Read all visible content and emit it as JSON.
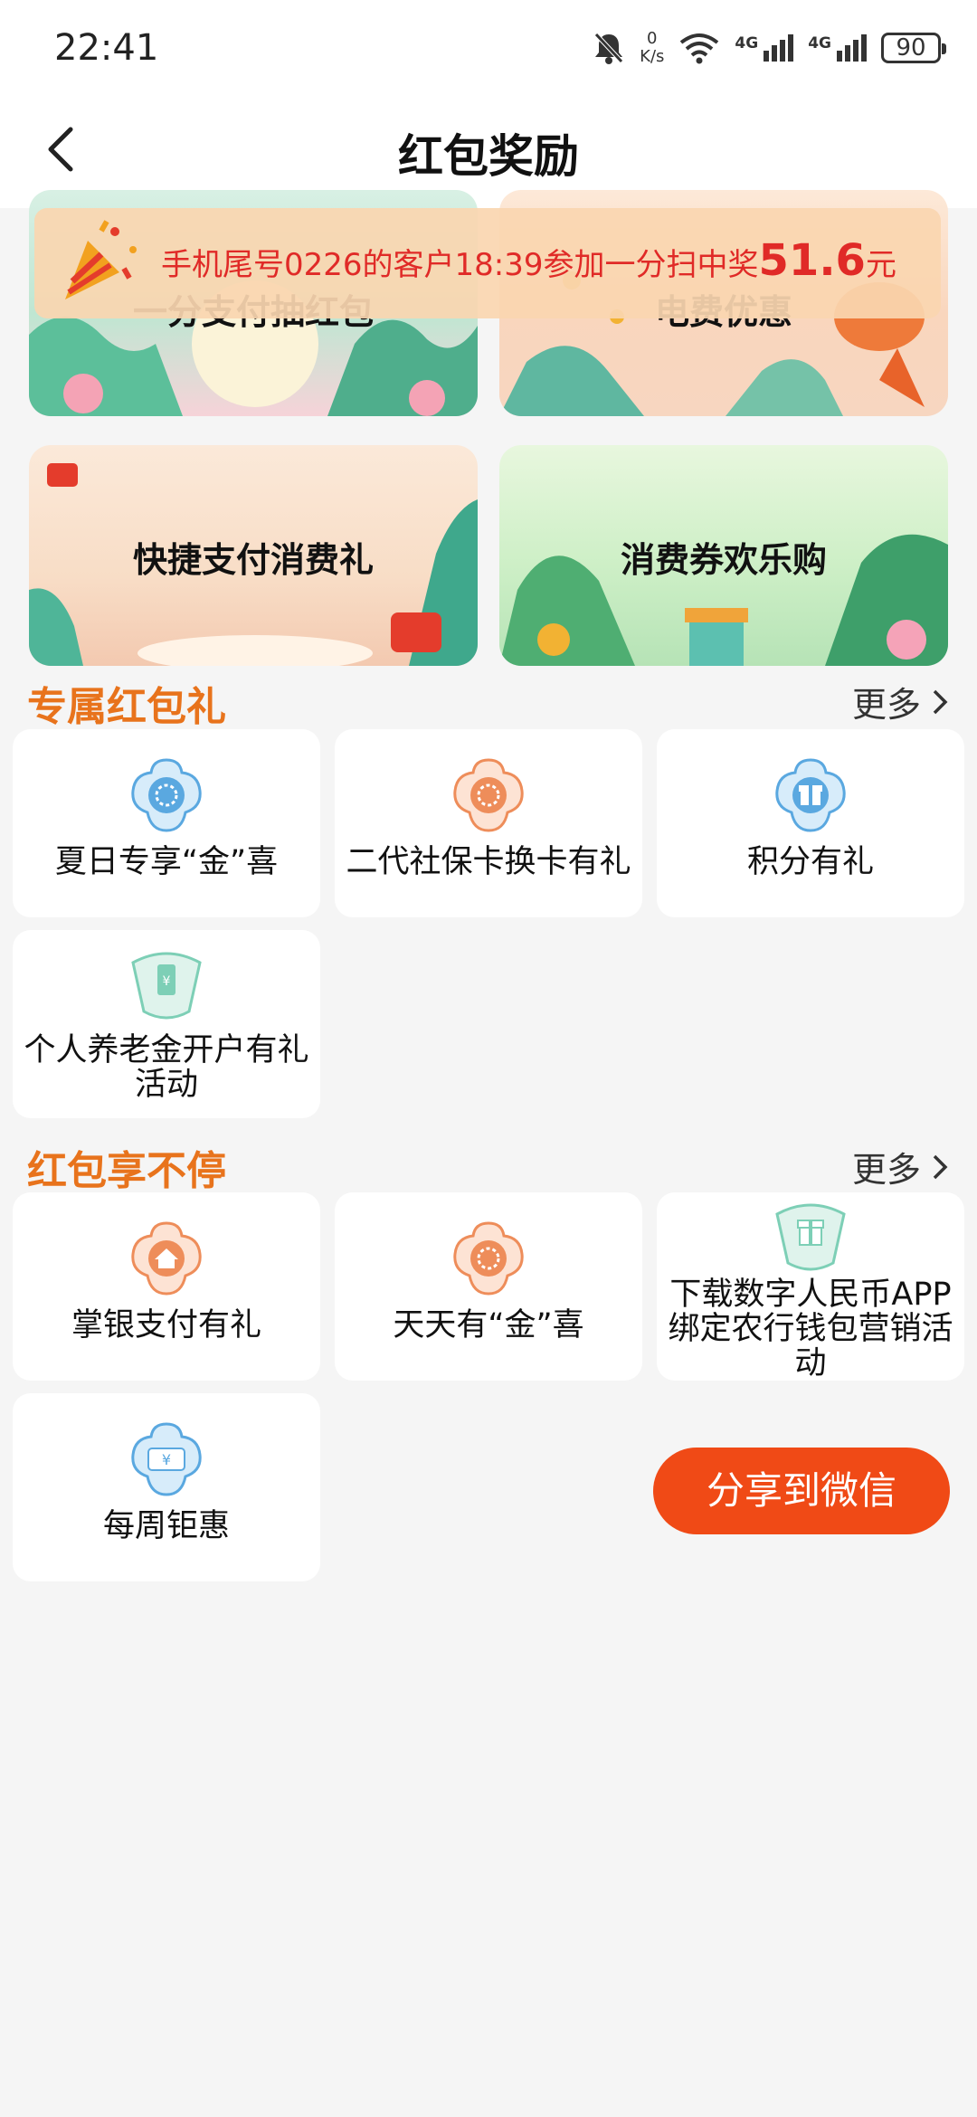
{
  "status_bar": {
    "time": "22:41",
    "net_speed_value": "0",
    "net_speed_unit": "K/s",
    "signal1_label": "4G",
    "signal2_label": "4G",
    "battery": "90"
  },
  "nav": {
    "title": "红包奖励"
  },
  "notice": {
    "text": "手机尾号0226的客户18:39参加一分扫中奖",
    "amount": "51.6",
    "unit": "元"
  },
  "banners": [
    {
      "label": "一分支付抽红包"
    },
    {
      "label": "电费优惠"
    },
    {
      "label": "快捷支付消费礼"
    },
    {
      "label": "消费券欢乐购"
    }
  ],
  "sections": [
    {
      "title": "专属红包礼",
      "more": "更多",
      "items": [
        {
          "label": "夏日专享“金”喜",
          "icon": "flower-icon"
        },
        {
          "label": "二代社保卡换卡有礼",
          "icon": "flower-icon"
        },
        {
          "label": "积分有礼",
          "icon": "gift-icon"
        },
        {
          "label": "个人养老金开户有礼活动",
          "icon": "pension-badge-icon"
        }
      ]
    },
    {
      "title": "红包享不停",
      "more": "更多",
      "items": [
        {
          "label": "掌银支付有礼",
          "icon": "house-icon"
        },
        {
          "label": "天天有“金”喜",
          "icon": "flower-icon"
        },
        {
          "label": "下载数字人民币APP绑定农行钱包营销活动",
          "icon": "gift-badge-icon"
        },
        {
          "label": "每周钜惠",
          "icon": "yuan-ticket-icon"
        }
      ]
    }
  ],
  "share_button": {
    "label": "分享到微信"
  },
  "colors": {
    "accent_orange": "#e8731c",
    "share_red": "#f04a16",
    "notice_red": "#e02a27",
    "icon_blue": "#5aa8e0",
    "icon_orange": "#ee8d5a",
    "icon_green": "#7dcfb6"
  }
}
